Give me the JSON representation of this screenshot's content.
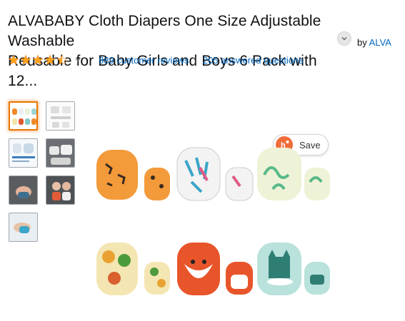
{
  "product": {
    "title_line1": "ALVABABY Cloth Diapers One Size Adjustable Washable",
    "title_line2": "Reusable for Baby Girls and Boys 6 Pack with 12...",
    "by_prefix": "by",
    "brand": "ALVA"
  },
  "rating": {
    "stars_value": 4.5,
    "reviews_link": "889 customer reviews",
    "separator": "|",
    "answers_link": "205 answered questions"
  },
  "gallery": {
    "save_label": "Save",
    "thumbnails": [
      "thumb-1",
      "thumb-2",
      "thumb-3",
      "thumb-4",
      "thumb-5",
      "thumb-6",
      "thumb-7"
    ]
  },
  "colors": {
    "link": "#0066c0",
    "star": "#ffa41c",
    "selected_border": "#e77600",
    "save_icon": "#ef6c3a"
  }
}
